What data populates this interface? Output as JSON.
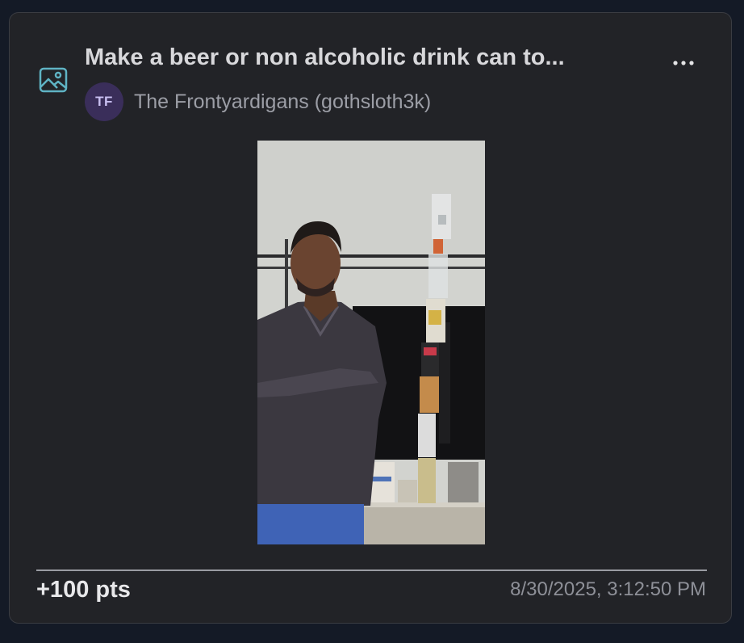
{
  "post": {
    "title": "Make a beer or non alcoholic drink can to...",
    "menu_icon": "more-horizontal-icon",
    "type_icon": "image-icon",
    "author": {
      "initials": "TF",
      "name": "The Frontyardigans (gothsloth3k)"
    },
    "media": {
      "kind": "photo"
    },
    "points": "+100 pts",
    "timestamp": "8/30/2025, 3:12:50 PM"
  },
  "colors": {
    "page_background": "#141a26",
    "card_background": "#222327",
    "card_border": "#3a3c42",
    "icon_accent": "#5fb3c4",
    "avatar_background": "#3a2e5a",
    "avatar_text": "#c8bff0"
  }
}
